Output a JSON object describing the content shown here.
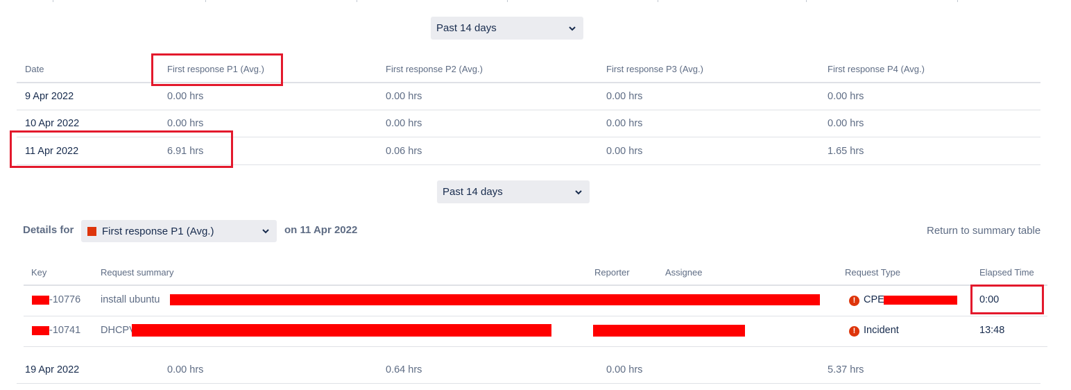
{
  "colors": {
    "accent_red": "#e3192c",
    "redaction": "#ff0000",
    "series_square": "#de350b"
  },
  "period_select_top": {
    "value": "Past 14 days"
  },
  "summary_table": {
    "headers": [
      "Date",
      "First response P1 (Avg.)",
      "First response P2 (Avg.)",
      "First response P3 (Avg.)",
      "First response P4 (Avg.)"
    ],
    "rows": [
      [
        "9 Apr 2022",
        "0.00 hrs",
        "0.00 hrs",
        "0.00 hrs",
        "0.00 hrs"
      ],
      [
        "10 Apr 2022",
        "0.00 hrs",
        "0.00 hrs",
        "0.00 hrs",
        "0.00 hrs"
      ],
      [
        "11 Apr 2022",
        "6.91 hrs",
        "0.06 hrs",
        "0.00 hrs",
        "1.65 hrs"
      ]
    ]
  },
  "period_select_bottom": {
    "value": "Past 14 days"
  },
  "details": {
    "label": "Details for",
    "metric_select": "First response P1 (Avg.)",
    "date_label": "on 11 Apr 2022",
    "return_link": "Return to summary table",
    "headers": [
      "Key",
      "Request summary",
      "Reporter",
      "Assignee",
      "Request Type",
      "Elapsed Time"
    ],
    "rows": [
      {
        "key": "-10776",
        "summary": "install ubuntu",
        "request_type": "CPE",
        "type_icon": "alert-icon",
        "elapsed": "0:00"
      },
      {
        "key": "-10741",
        "summary": "DHCPV",
        "request_type": "Incident",
        "type_icon": "alert-icon",
        "elapsed": "13:48"
      }
    ]
  },
  "last_row": [
    "19 Apr 2022",
    "0.00 hrs",
    "0.64 hrs",
    "0.00 hrs",
    "5.37 hrs"
  ]
}
